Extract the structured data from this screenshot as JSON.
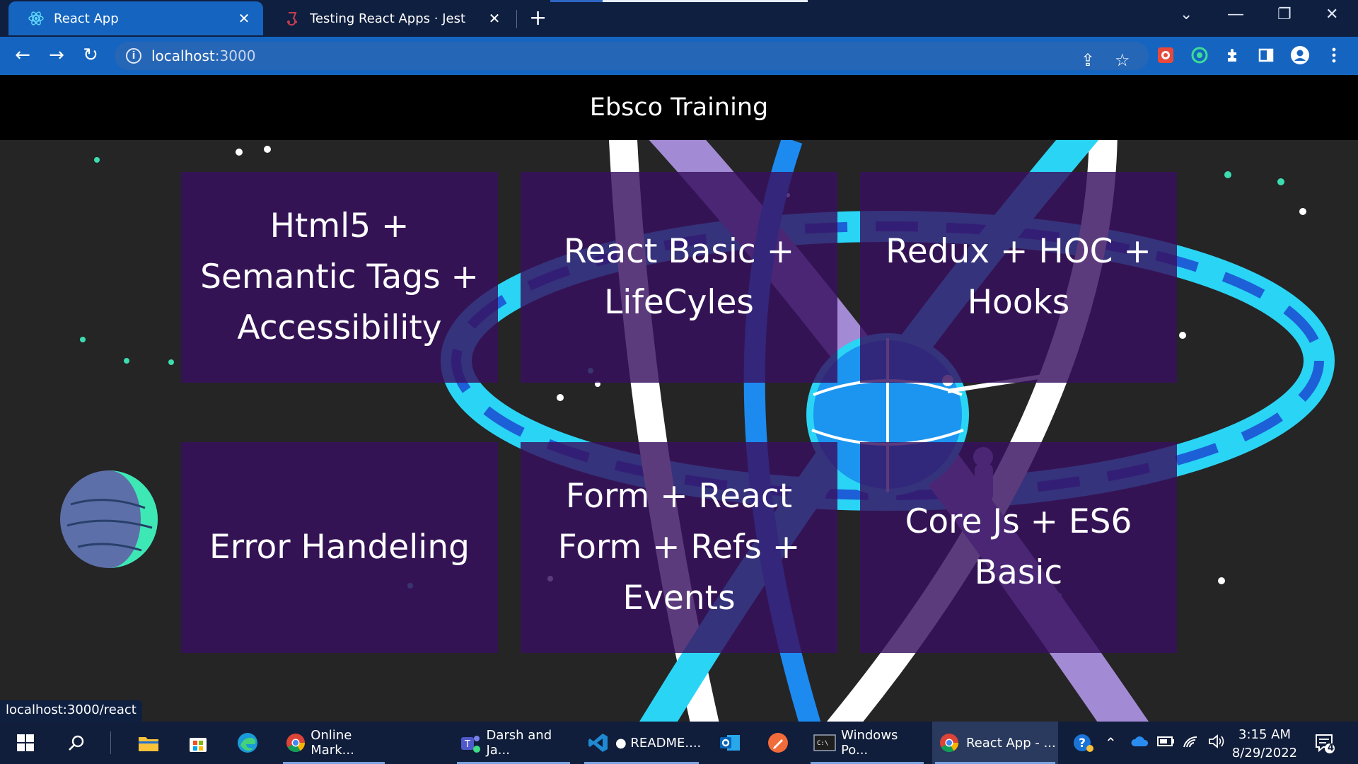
{
  "browser": {
    "tabs": [
      {
        "title": "React App",
        "active": true
      },
      {
        "title": "Testing React Apps · Jest",
        "active": false
      }
    ],
    "close_glyph": "✕",
    "new_tab_glyph": "+",
    "address": {
      "host": "localhost",
      "port": ":3000"
    },
    "status_url": "localhost:3000/react"
  },
  "app": {
    "title": "Ebsco Training",
    "cards": [
      {
        "label": "Html5 + Semantic Tags + Accessibility"
      },
      {
        "label": "React Basic + LifeCyles"
      },
      {
        "label": "Redux + HOC + Hooks"
      },
      {
        "label": "Error Handeling"
      },
      {
        "label": "Form + React Form + Refs + Events"
      },
      {
        "label": "Core Js + ES6 Basic"
      }
    ]
  },
  "taskbar": {
    "apps": [
      {
        "label": "Online Mark...",
        "icon": "chrome-icon"
      },
      {
        "label": "Darsh and Ja...",
        "icon": "teams-icon"
      },
      {
        "label": "● README....",
        "icon": "vscode-icon"
      },
      {
        "label": "Windows Po...",
        "icon": "terminal-icon"
      },
      {
        "label": "React App - ...",
        "icon": "chrome-icon"
      }
    ],
    "time": "3:15 AM",
    "date": "8/29/2022",
    "notifications": "4"
  },
  "colors": {
    "tab_active": "#1565c0",
    "toolbar": "#1565c0",
    "header": "#000000",
    "card": "#381060",
    "cyan": "#2ad4f5",
    "lavender": "#a28ad4"
  }
}
